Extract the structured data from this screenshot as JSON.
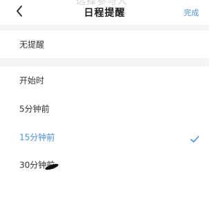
{
  "nav": {
    "ghost_title": "选择参与人",
    "back_icon": "chevron-left-icon",
    "title": "日程提醒",
    "done_label": "完成"
  },
  "rows": [
    {
      "label": "无提醒",
      "selected": false
    },
    {
      "label": "开始时",
      "selected": false
    },
    {
      "label": "5分钟前",
      "selected": false
    },
    {
      "label": "15分钟前",
      "selected": true
    },
    {
      "label": "30分钟前",
      "selected": false
    }
  ],
  "check_icon": "checkmark-icon",
  "colors": {
    "accent": "#4a90e2",
    "text": "#333333",
    "separator": "#f4f5f7",
    "background": "#ffffff"
  }
}
